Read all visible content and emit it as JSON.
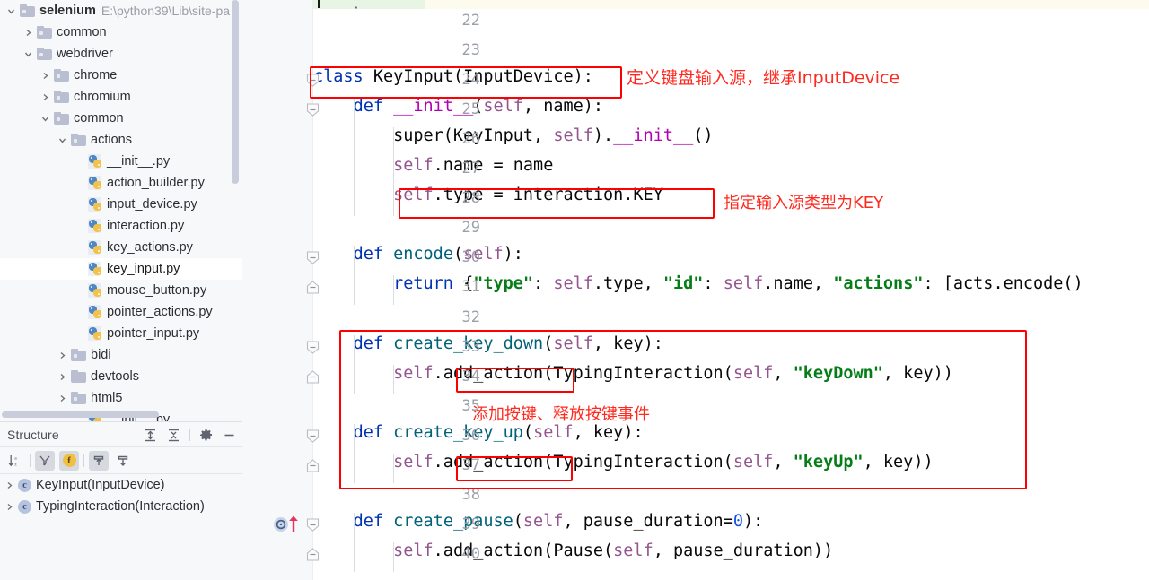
{
  "sidebar": {
    "project_tree": [
      {
        "indent": 0,
        "chevron": "down",
        "icon": "folder-icon",
        "label": "selenium",
        "bold": true,
        "path": "E:\\python39\\Lib\\site-pa",
        "selected": false
      },
      {
        "indent": 1,
        "chevron": "right",
        "icon": "folder-icon",
        "label": "common",
        "bold": false,
        "path": "",
        "selected": false
      },
      {
        "indent": 1,
        "chevron": "down",
        "icon": "folder-icon",
        "label": "webdriver",
        "bold": false,
        "path": "",
        "selected": false
      },
      {
        "indent": 2,
        "chevron": "right",
        "icon": "folder-icon",
        "label": "chrome",
        "bold": false,
        "path": "",
        "selected": false
      },
      {
        "indent": 2,
        "chevron": "right",
        "icon": "folder-icon",
        "label": "chromium",
        "bold": false,
        "path": "",
        "selected": false
      },
      {
        "indent": 2,
        "chevron": "down",
        "icon": "folder-icon",
        "label": "common",
        "bold": false,
        "path": "",
        "selected": false
      },
      {
        "indent": 3,
        "chevron": "down",
        "icon": "folder-icon",
        "label": "actions",
        "bold": false,
        "path": "",
        "selected": false
      },
      {
        "indent": 4,
        "chevron": "none",
        "icon": "python-file-icon",
        "label": "__init__.py",
        "bold": false,
        "path": "",
        "selected": false
      },
      {
        "indent": 4,
        "chevron": "none",
        "icon": "python-file-icon",
        "label": "action_builder.py",
        "bold": false,
        "path": "",
        "selected": false
      },
      {
        "indent": 4,
        "chevron": "none",
        "icon": "python-file-icon",
        "label": "input_device.py",
        "bold": false,
        "path": "",
        "selected": false
      },
      {
        "indent": 4,
        "chevron": "none",
        "icon": "python-file-icon",
        "label": "interaction.py",
        "bold": false,
        "path": "",
        "selected": false
      },
      {
        "indent": 4,
        "chevron": "none",
        "icon": "python-file-icon",
        "label": "key_actions.py",
        "bold": false,
        "path": "",
        "selected": false
      },
      {
        "indent": 4,
        "chevron": "none",
        "icon": "python-file-icon",
        "label": "key_input.py",
        "bold": false,
        "path": "",
        "selected": true
      },
      {
        "indent": 4,
        "chevron": "none",
        "icon": "python-file-icon",
        "label": "mouse_button.py",
        "bold": false,
        "path": "",
        "selected": false
      },
      {
        "indent": 4,
        "chevron": "none",
        "icon": "python-file-icon",
        "label": "pointer_actions.py",
        "bold": false,
        "path": "",
        "selected": false
      },
      {
        "indent": 4,
        "chevron": "none",
        "icon": "python-file-icon",
        "label": "pointer_input.py",
        "bold": false,
        "path": "",
        "selected": false
      },
      {
        "indent": 3,
        "chevron": "right",
        "icon": "folder-icon",
        "label": "bidi",
        "bold": false,
        "path": "",
        "selected": false
      },
      {
        "indent": 3,
        "chevron": "right",
        "icon": "folder-plain-icon",
        "label": "devtools",
        "bold": false,
        "path": "",
        "selected": false
      },
      {
        "indent": 3,
        "chevron": "right",
        "icon": "folder-icon",
        "label": "html5",
        "bold": false,
        "path": "",
        "selected": false
      },
      {
        "indent": 4,
        "chevron": "none",
        "icon": "python-file-icon",
        "label": "__init__.py",
        "bold": false,
        "path": "",
        "selected": false
      }
    ]
  },
  "structure": {
    "title": "Structure",
    "header_actions": [
      {
        "name": "expand-all-icon",
        "tooltip": "Expand All"
      },
      {
        "name": "collapse-all-icon",
        "tooltip": "Collapse All"
      },
      {
        "name": "gear-icon",
        "tooltip": "Settings"
      },
      {
        "name": "minimize-icon",
        "tooltip": "Hide"
      }
    ],
    "toolbar": [
      {
        "name": "sort-alphabetically-icon",
        "active": false,
        "glyph": "sortaz"
      },
      {
        "name": "filter-icon",
        "active": true,
        "glyph": "filter"
      },
      {
        "name": "show-fields-icon",
        "active": true,
        "glyph": "f"
      },
      {
        "name": "show-inherited-up-icon",
        "active": true,
        "glyph": "up"
      },
      {
        "name": "show-inherited-down-icon",
        "active": false,
        "glyph": "down"
      }
    ],
    "rows": [
      {
        "badge": "c",
        "label": "KeyInput(InputDevice)"
      },
      {
        "badge": "c",
        "label": "TypingInteraction(Interaction)"
      }
    ]
  },
  "editor": {
    "line_numbers": [
      22,
      23,
      24,
      25,
      26,
      27,
      28,
      29,
      30,
      31,
      32,
      33,
      34,
      35,
      36,
      37,
      38,
      39,
      40
    ],
    "lines": [
      {
        "num": 22,
        "tokens": []
      },
      {
        "num": 23,
        "tokens": []
      },
      {
        "num": 24,
        "tokens": [
          {
            "t": "class ",
            "c": "kw"
          },
          {
            "t": "KeyInput",
            "c": "pln"
          },
          {
            "t": "(",
            "c": "pln"
          },
          {
            "t": "InputDevice",
            "c": "pln"
          },
          {
            "t": "):",
            "c": "pln"
          }
        ]
      },
      {
        "num": 25,
        "tokens": [
          {
            "t": "    ",
            "c": "pln"
          },
          {
            "t": "def ",
            "c": "kw"
          },
          {
            "t": "__init__",
            "c": "dun"
          },
          {
            "t": "(",
            "c": "pln"
          },
          {
            "t": "self",
            "c": "slf"
          },
          {
            "t": ", name):",
            "c": "pln"
          }
        ]
      },
      {
        "num": 26,
        "tokens": [
          {
            "t": "        super(KeyInput, ",
            "c": "pln"
          },
          {
            "t": "self",
            "c": "slf"
          },
          {
            "t": ").",
            "c": "pln"
          },
          {
            "t": "__init__",
            "c": "dun"
          },
          {
            "t": "()",
            "c": "pln"
          }
        ]
      },
      {
        "num": 27,
        "tokens": [
          {
            "t": "        ",
            "c": "pln"
          },
          {
            "t": "self",
            "c": "slf"
          },
          {
            "t": ".name = name",
            "c": "pln"
          }
        ]
      },
      {
        "num": 28,
        "tokens": [
          {
            "t": "        ",
            "c": "pln"
          },
          {
            "t": "self",
            "c": "slf"
          },
          {
            "t": ".type = interaction.KEY",
            "c": "pln"
          }
        ]
      },
      {
        "num": 29,
        "tokens": []
      },
      {
        "num": 30,
        "tokens": [
          {
            "t": "    ",
            "c": "pln"
          },
          {
            "t": "def ",
            "c": "kw"
          },
          {
            "t": "encode",
            "c": "fn"
          },
          {
            "t": "(",
            "c": "pln"
          },
          {
            "t": "self",
            "c": "slf"
          },
          {
            "t": "):",
            "c": "pln"
          }
        ]
      },
      {
        "num": 31,
        "tokens": [
          {
            "t": "        ",
            "c": "pln"
          },
          {
            "t": "return ",
            "c": "kw"
          },
          {
            "t": "{",
            "c": "pln"
          },
          {
            "t": "\"type\"",
            "c": "str"
          },
          {
            "t": ": ",
            "c": "pln"
          },
          {
            "t": "self",
            "c": "slf"
          },
          {
            "t": ".type, ",
            "c": "pln"
          },
          {
            "t": "\"id\"",
            "c": "str"
          },
          {
            "t": ": ",
            "c": "pln"
          },
          {
            "t": "self",
            "c": "slf"
          },
          {
            "t": ".name, ",
            "c": "pln"
          },
          {
            "t": "\"actions\"",
            "c": "str"
          },
          {
            "t": ": [acts.encode()",
            "c": "pln"
          }
        ]
      },
      {
        "num": 32,
        "tokens": []
      },
      {
        "num": 33,
        "tokens": [
          {
            "t": "    ",
            "c": "pln"
          },
          {
            "t": "def ",
            "c": "kw"
          },
          {
            "t": "create_key_down",
            "c": "fn"
          },
          {
            "t": "(",
            "c": "pln"
          },
          {
            "t": "self",
            "c": "slf"
          },
          {
            "t": ", key):",
            "c": "pln"
          }
        ]
      },
      {
        "num": 34,
        "tokens": [
          {
            "t": "        ",
            "c": "pln"
          },
          {
            "t": "self",
            "c": "slf"
          },
          {
            "t": ".add_action(TypingInteraction(",
            "c": "pln"
          },
          {
            "t": "self",
            "c": "slf"
          },
          {
            "t": ", ",
            "c": "pln"
          },
          {
            "t": "\"keyDown\"",
            "c": "str"
          },
          {
            "t": ", key))",
            "c": "pln"
          }
        ]
      },
      {
        "num": 35,
        "tokens": []
      },
      {
        "num": 36,
        "tokens": [
          {
            "t": "    ",
            "c": "pln"
          },
          {
            "t": "def ",
            "c": "kw"
          },
          {
            "t": "create_key_up",
            "c": "fn"
          },
          {
            "t": "(",
            "c": "pln"
          },
          {
            "t": "self",
            "c": "slf"
          },
          {
            "t": ", key):",
            "c": "pln"
          }
        ]
      },
      {
        "num": 37,
        "tokens": [
          {
            "t": "        ",
            "c": "pln"
          },
          {
            "t": "self",
            "c": "slf"
          },
          {
            "t": ".add_action(TypingInteraction(",
            "c": "pln"
          },
          {
            "t": "self",
            "c": "slf"
          },
          {
            "t": ", ",
            "c": "pln"
          },
          {
            "t": "\"keyUp\"",
            "c": "str"
          },
          {
            "t": ", key))",
            "c": "pln"
          }
        ]
      },
      {
        "num": 38,
        "tokens": []
      },
      {
        "num": 39,
        "tokens": [
          {
            "t": "    ",
            "c": "pln"
          },
          {
            "t": "def ",
            "c": "kw"
          },
          {
            "t": "create_pause",
            "c": "fn"
          },
          {
            "t": "(",
            "c": "pln"
          },
          {
            "t": "self",
            "c": "slf"
          },
          {
            "t": ", pause_duration=",
            "c": "pln"
          },
          {
            "t": "0",
            "c": "num"
          },
          {
            "t": "):",
            "c": "pln"
          }
        ]
      },
      {
        "num": 40,
        "tokens": [
          {
            "t": "        ",
            "c": "pln"
          },
          {
            "t": "self",
            "c": "slf"
          },
          {
            "t": ".add_action(Pause(",
            "c": "pln"
          },
          {
            "t": "self",
            "c": "slf"
          },
          {
            "t": ", pause_duration))",
            "c": "pln"
          }
        ]
      }
    ],
    "gutter_run_marker": {
      "line": 39,
      "name": "run-method-gutter-icon"
    }
  },
  "annotations": {
    "color": "#ff0000",
    "text_color": "#ff2a1f",
    "notes": [
      {
        "name": "annotation-class-keyinput",
        "text": "定义键盘输入源，继承InputDevice"
      },
      {
        "name": "annotation-input-type-key",
        "text": "指定输入源类型为KEY"
      },
      {
        "name": "annotation-add-release-key-events",
        "text": "添加按键、释放按键事件"
      }
    ],
    "boxes": [
      {
        "name": "highlight-box-class-declaration"
      },
      {
        "name": "highlight-box-self-type"
      },
      {
        "name": "highlight-box-key-methods"
      },
      {
        "name": "highlight-box-add-action-down"
      },
      {
        "name": "highlight-box-add-action-up"
      }
    ]
  }
}
